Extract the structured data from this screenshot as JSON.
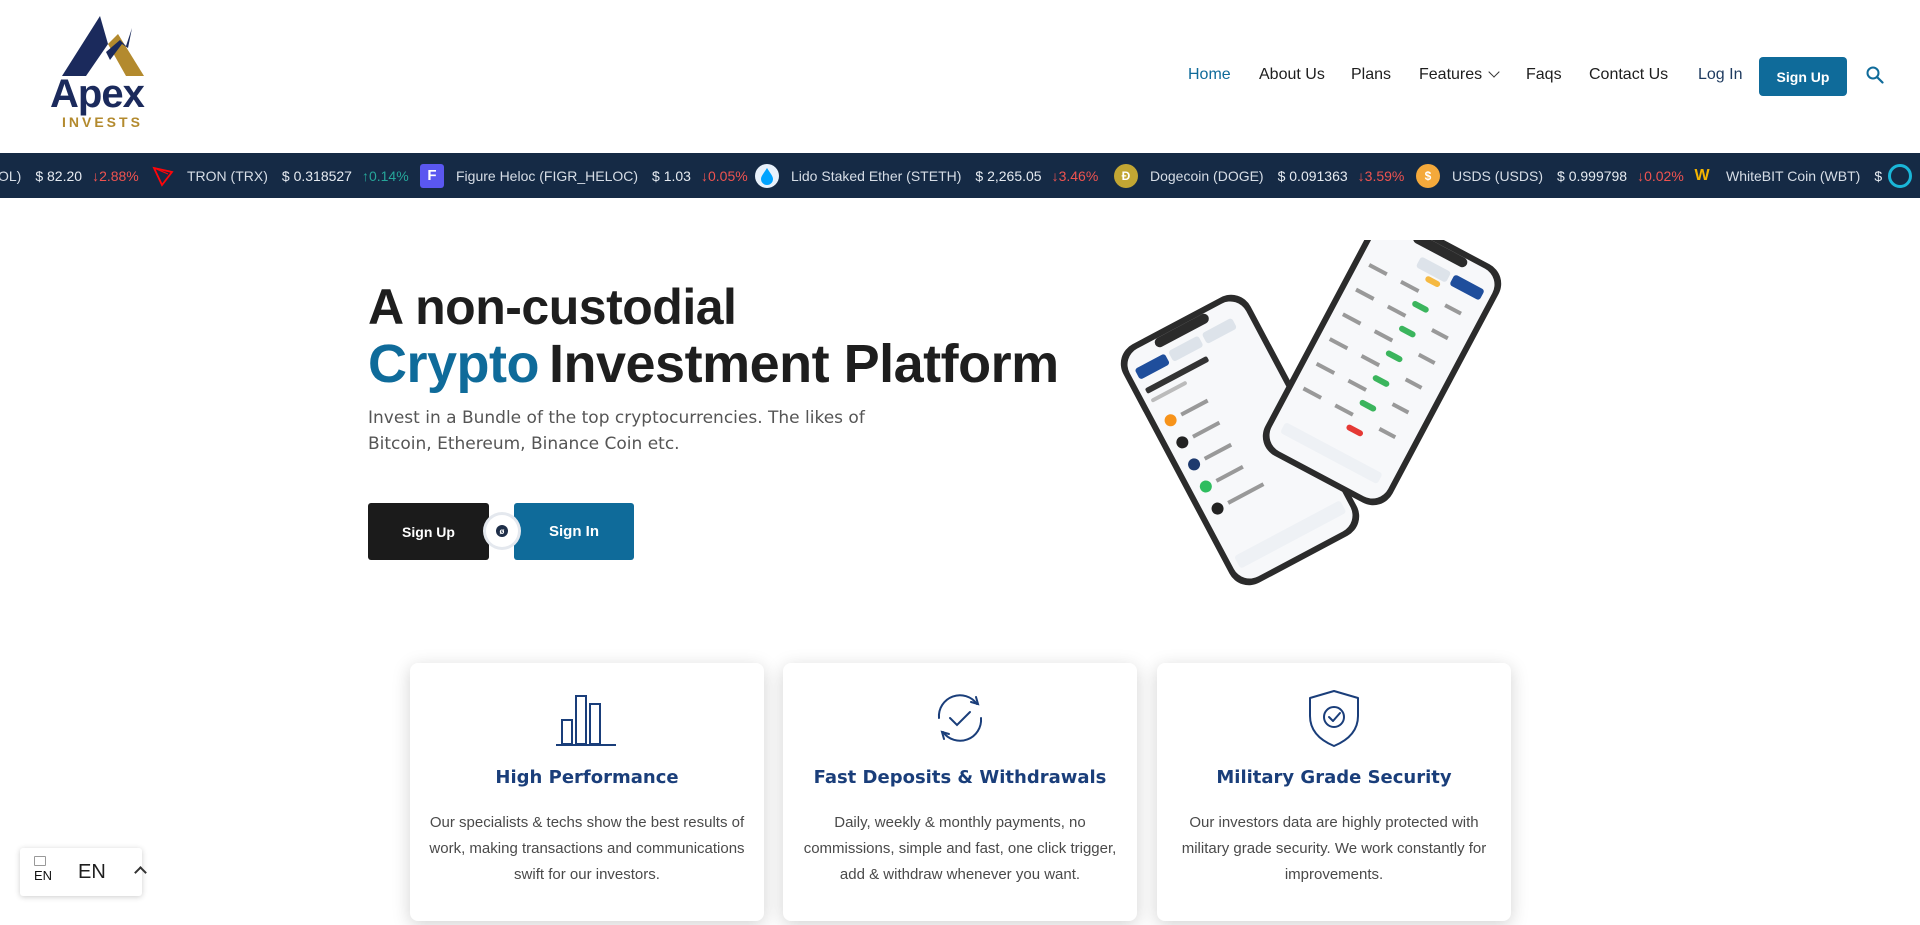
{
  "brand": {
    "name": "Apex",
    "tagline": "INVESTS"
  },
  "nav": {
    "items": [
      {
        "label": "Home",
        "active": true
      },
      {
        "label": "About Us"
      },
      {
        "label": "Plans"
      },
      {
        "label": "Features",
        "has_dropdown": true
      },
      {
        "label": "Faqs"
      },
      {
        "label": "Contact Us"
      }
    ],
    "login_label": "Log In",
    "signup_label": "Sign Up"
  },
  "ticker": [
    {
      "name": "OL)",
      "price": "$ 82.20",
      "change": "2.88%",
      "direction": "down",
      "icon": "sol-icon",
      "color": ""
    },
    {
      "name": "TRON (TRX)",
      "price": "$ 0.318527",
      "change": "0.14%",
      "direction": "up",
      "icon": "tron-icon",
      "color": "#ff060a"
    },
    {
      "name": "Figure Heloc (FIGR_HELOC)",
      "price": "$ 1.03",
      "change": "0.05%",
      "direction": "down",
      "icon": "figure-icon",
      "color": "#5a57f0"
    },
    {
      "name": "Lido Staked Ether (STETH)",
      "price": "$ 2,265.05",
      "change": "3.46%",
      "direction": "down",
      "icon": "lido-icon",
      "color": "#e8f1fb"
    },
    {
      "name": "Dogecoin (DOGE)",
      "price": "$ 0.091363",
      "change": "3.59%",
      "direction": "down",
      "icon": "dogecoin-icon",
      "color": "#c2a633"
    },
    {
      "name": "USDS (USDS)",
      "price": "$ 0.999798",
      "change": "0.02%",
      "direction": "down",
      "icon": "usds-icon",
      "color": "#f4a93b"
    },
    {
      "name": "WhiteBIT Coin (WBT)",
      "price": "$",
      "change": "",
      "direction": "",
      "icon": "whitebit-icon",
      "color": "#111"
    }
  ],
  "hero": {
    "title_line1": "A non-custodial",
    "title_accent": "Crypto",
    "title_rest": "Investment Platform",
    "subtitle": "Invest in a Bundle of the top cryptocurrencies. The likes of Bitcoin, Ethereum, Binance Coin etc.",
    "signup_label": "Sign Up",
    "signin_label": "Sign In"
  },
  "features": [
    {
      "title": "High Performance",
      "text": "Our specialists & techs show the best results of work, making transactions and communications swift for our investors.",
      "icon": "bar-chart-icon"
    },
    {
      "title": "Fast Deposits & Withdrawals",
      "text": "Daily, weekly & monthly payments, no commissions, simple and fast, one click trigger, add & withdraw whenever you want.",
      "icon": "refresh-check-icon"
    },
    {
      "title": "Military Grade Security",
      "text": "Our investors data are highly protected with military grade security. We work constantly for improvements.",
      "icon": "shield-check-icon"
    }
  ],
  "language": {
    "code": "EN",
    "flag_alt": "EN"
  },
  "colors": {
    "accent": "#0f6b9a",
    "ticker_bg": "#152a45",
    "title_blue": "#1a3e7a",
    "dark_button": "#1b1b1b"
  }
}
